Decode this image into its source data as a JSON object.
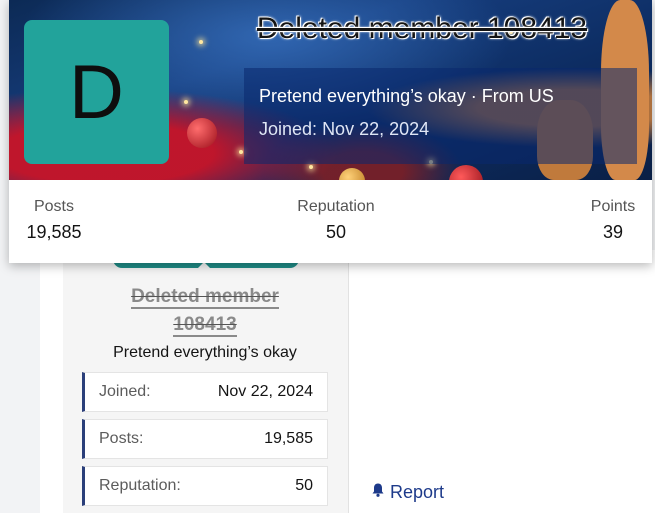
{
  "card": {
    "avatar_letter": "D",
    "username": "Deleted member 108413",
    "user_title": "Pretend everything’s okay",
    "separator": " · ",
    "location": "From US",
    "joined_label": "Joined:",
    "joined_value": "Nov 22, 2024",
    "stats": [
      {
        "label": "Posts",
        "value": "19,585"
      },
      {
        "label": "Reputation",
        "value": "50"
      },
      {
        "label": "Points",
        "value": "39"
      }
    ]
  },
  "post_user": {
    "username_line1": "Deleted member",
    "username_line2": "108413",
    "user_title": "Pretend everything’s okay",
    "stats": [
      {
        "label": "Joined:",
        "value": "Nov 22, 2024"
      },
      {
        "label": "Posts:",
        "value": "19,585"
      },
      {
        "label": "Reputation:",
        "value": "50"
      }
    ]
  },
  "actions": {
    "report_label": "Report",
    "report_icon": "bell-icon"
  },
  "colors": {
    "avatar_bg": "#22a39b",
    "accent_border": "#2b3f7a",
    "link": "#1d3a8a"
  }
}
